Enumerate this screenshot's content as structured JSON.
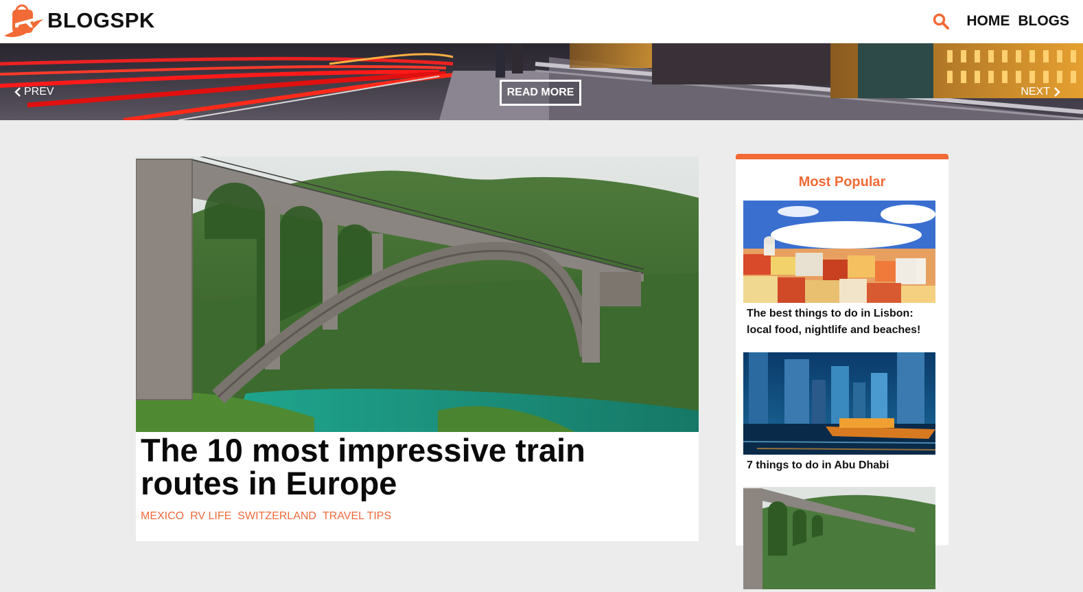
{
  "header": {
    "logo_text": "BLOGSPK",
    "nav": {
      "home": "HOME",
      "blogs": "BLOGS"
    },
    "search_icon": "search-icon",
    "accent_color": "#f26a35"
  },
  "hero": {
    "prev_label": "PREV",
    "next_label": "NEXT",
    "read_more_label": "READ MORE"
  },
  "article": {
    "title": "The 10 most impressive train routes in Europe",
    "tags": [
      "MEXICO",
      "RV LIFE",
      "SWITZERLAND",
      "TRAVEL TIPS"
    ],
    "tag_color": "#ef6a3b"
  },
  "sidebar": {
    "title": "Most Popular",
    "items": [
      {
        "caption": "The best things to do in Lisbon: local food, nightlife and beaches!"
      },
      {
        "caption": "7 things to do in Abu Dhabi"
      },
      {
        "caption": ""
      }
    ]
  }
}
